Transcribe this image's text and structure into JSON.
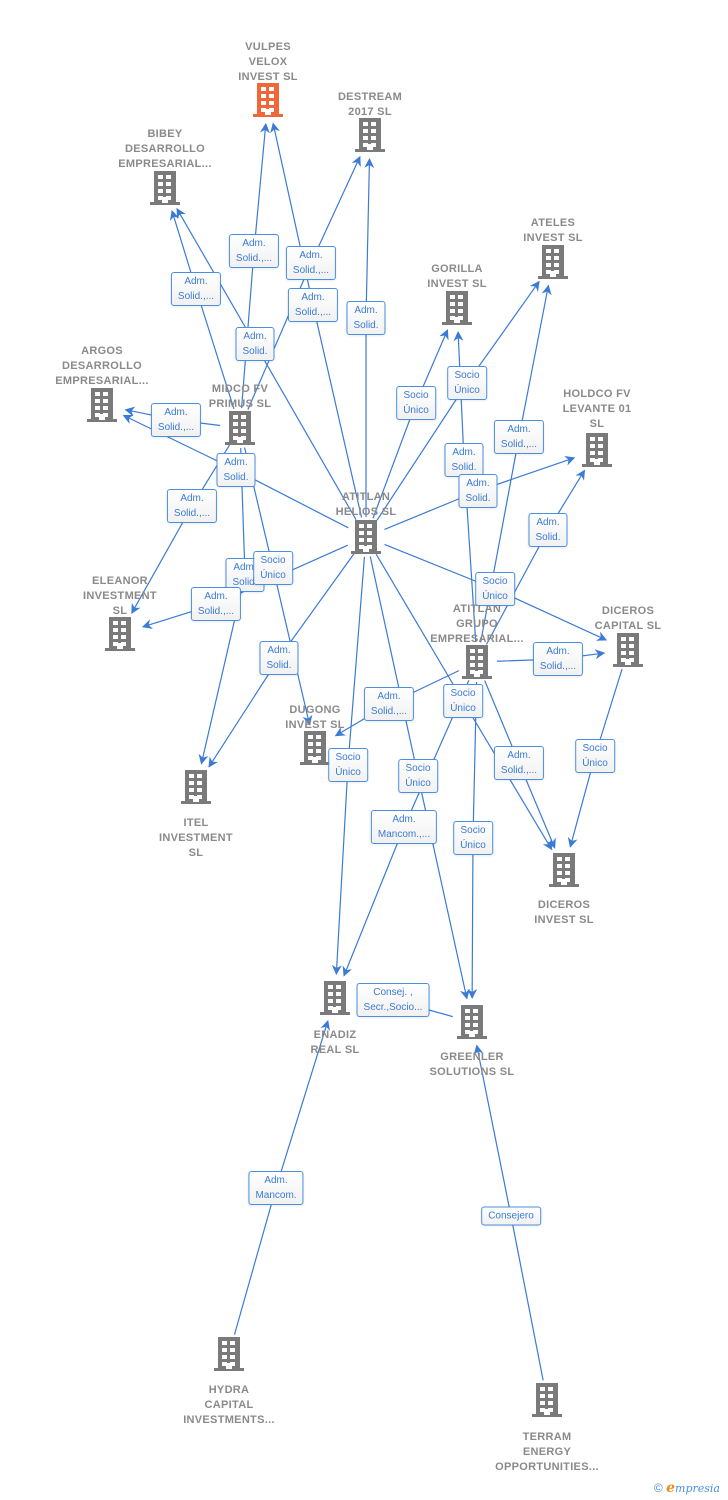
{
  "colors": {
    "edge": "#3a7bd5",
    "node": "#7a7a7a",
    "focus_node": "#f0673a"
  },
  "nodes": [
    {
      "id": "vulpes",
      "label": "VULPES\nVELOX\nINVEST  SL",
      "focus": true,
      "icon": "building-icon"
    },
    {
      "id": "destream",
      "label": "DESTREAM\n2017  SL",
      "icon": "building-icon"
    },
    {
      "id": "bibey",
      "label": "BIBEY\nDESARROLLO\nEMPRESARIAL...",
      "icon": "building-icon"
    },
    {
      "id": "ateles",
      "label": "ATELES\nINVEST  SL",
      "icon": "building-icon"
    },
    {
      "id": "gorilla",
      "label": "GORILLA\nINVEST  SL",
      "icon": "building-icon"
    },
    {
      "id": "argos",
      "label": "ARGOS\nDESARROLLO\nEMPRESARIAL...",
      "icon": "building-icon"
    },
    {
      "id": "midco",
      "label": "MIDCO FV\nPRIMUS  SL",
      "icon": "building-icon"
    },
    {
      "id": "holdco",
      "label": "HOLDCO FV\nLEVANTE 01\nSL",
      "icon": "building-icon"
    },
    {
      "id": "helios",
      "label": "ATITLAN\nHELIOS  SL",
      "icon": "building-icon"
    },
    {
      "id": "eleanor",
      "label": "ELEANOR\nINVESTMENT\nSL",
      "icon": "building-icon"
    },
    {
      "id": "grupo",
      "label": "ATITLAN\nGRUPO\nEMPRESARIAL...",
      "icon": "building-icon"
    },
    {
      "id": "dcapital",
      "label": "DICEROS\nCAPITAL  SL",
      "icon": "building-icon"
    },
    {
      "id": "dugong",
      "label": "DUGONG\nINVEST  SL",
      "icon": "building-icon"
    },
    {
      "id": "itel",
      "label": "ITEL\nINVESTMENT\nSL",
      "icon": "building-icon"
    },
    {
      "id": "dinvest",
      "label": "DICEROS\nINVEST  SL",
      "icon": "building-icon"
    },
    {
      "id": "enadiz",
      "label": "ENADIZ\nREAL  SL",
      "icon": "building-icon"
    },
    {
      "id": "greenler",
      "label": "GREENLER\nSOLUTIONS  SL",
      "icon": "building-icon"
    },
    {
      "id": "hydra",
      "label": "HYDRA\nCAPITAL\nINVESTMENTS...",
      "icon": "building-icon"
    },
    {
      "id": "terram",
      "label": "TERRAM\nENERGY\nOPPORTUNITIES...",
      "icon": "building-icon"
    }
  ],
  "edges": [
    {
      "from": "midco",
      "to": "vulpes",
      "label": "Adm.\nSolid.,..."
    },
    {
      "from": "midco",
      "to": "destream",
      "label": "Adm.\nSolid.,..."
    },
    {
      "from": "helios",
      "to": "vulpes",
      "label": "Adm.\nSolid.,..."
    },
    {
      "from": "helios",
      "to": "destream",
      "label": "Adm.\nSolid."
    },
    {
      "from": "midco",
      "to": "bibey",
      "label": "Adm.\nSolid.,..."
    },
    {
      "from": "helios",
      "to": "bibey",
      "label": "Adm.\nSolid."
    },
    {
      "from": "midco",
      "to": "argos",
      "label": "Adm.\nSolid.,..."
    },
    {
      "from": "helios",
      "to": "argos",
      "label": "Adm.\nSolid."
    },
    {
      "from": "midco",
      "to": "eleanor",
      "label": "Adm.\nSolid.,..."
    },
    {
      "from": "midco",
      "to": "itel",
      "label": "Adm.\nSolid."
    },
    {
      "from": "helios",
      "to": "eleanor",
      "label": "Adm.\nSolid.,..."
    },
    {
      "from": "midco",
      "to": "dugong",
      "label": "Socio\nÚnico"
    },
    {
      "from": "helios",
      "to": "itel",
      "label": "Adm.\nSolid."
    },
    {
      "from": "helios",
      "to": "gorilla",
      "label": "Socio\nÚnico"
    },
    {
      "from": "helios",
      "to": "ateles",
      "label": "Socio\nÚnico"
    },
    {
      "from": "grupo",
      "to": "gorilla",
      "label": "Adm.\nSolid."
    },
    {
      "from": "grupo",
      "to": "ateles",
      "label": "Adm.\nSolid.,..."
    },
    {
      "from": "helios",
      "to": "holdco",
      "label": "Adm.\nSolid."
    },
    {
      "from": "grupo",
      "to": "holdco",
      "label": "Adm.\nSolid."
    },
    {
      "from": "helios",
      "to": "dcapital",
      "label": "Socio\nÚnico"
    },
    {
      "from": "grupo",
      "to": "dcapital",
      "label": "Adm.\nSolid.,..."
    },
    {
      "from": "grupo",
      "to": "dugong",
      "label": "Adm.\nSolid.,..."
    },
    {
      "from": "helios",
      "to": "dinvest",
      "label": "Socio\nÚnico"
    },
    {
      "from": "grupo",
      "to": "dinvest",
      "label": "Adm.\nSolid.,..."
    },
    {
      "from": "helios",
      "to": "enadiz",
      "label": "Socio\nÚnico"
    },
    {
      "from": "helios",
      "to": "greenler",
      "label": "Socio\nÚnico"
    },
    {
      "from": "grupo",
      "to": "enadiz",
      "label": "Adm.\nMancom.,..."
    },
    {
      "from": "grupo",
      "to": "greenler",
      "label": "Socio\nÚnico"
    },
    {
      "from": "dcapital",
      "to": "dinvest",
      "label": "Socio\nÚnico"
    },
    {
      "from": "greenler",
      "to": "enadiz",
      "label": "Consej. ,\nSecr.,Socio..."
    },
    {
      "from": "hydra",
      "to": "enadiz",
      "label": "Adm.\nMancom."
    },
    {
      "from": "terram",
      "to": "greenler",
      "label": "Consejero"
    }
  ],
  "footer": {
    "copyright": "©",
    "brand_initial": "e",
    "brand_rest": "mpresia"
  }
}
